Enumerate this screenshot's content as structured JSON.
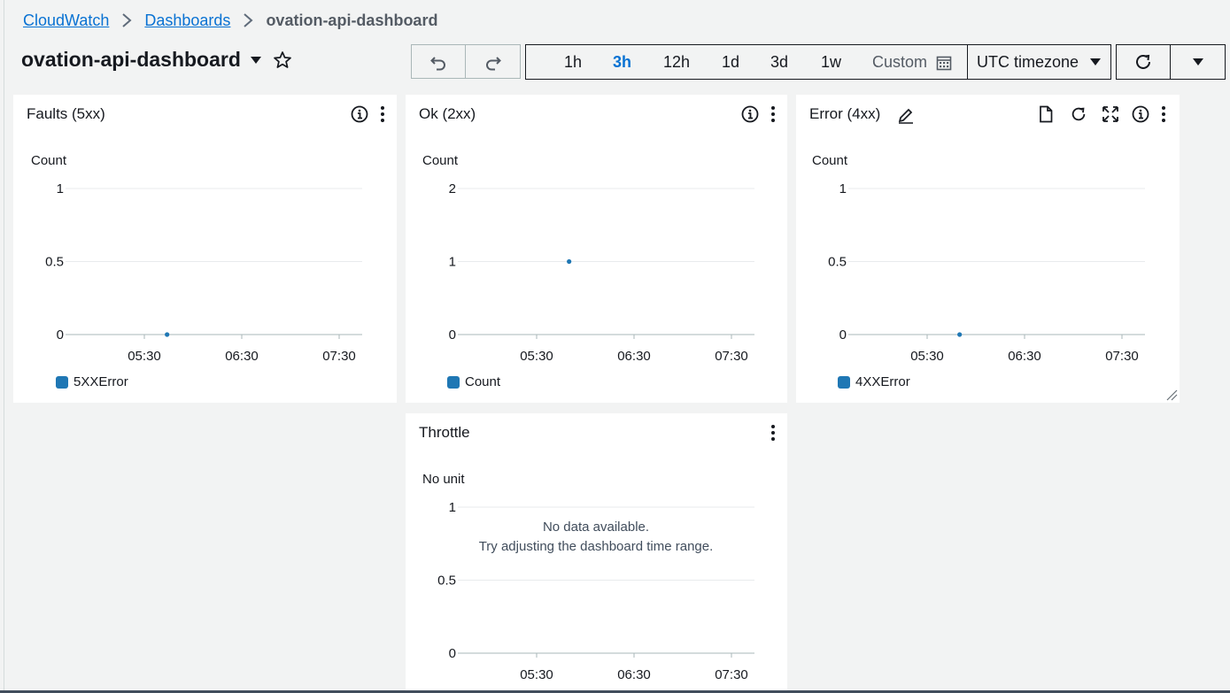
{
  "breadcrumb": {
    "root": "CloudWatch",
    "section": "Dashboards",
    "current": "ovation-api-dashboard"
  },
  "dashboard": {
    "title": "ovation-api-dashboard"
  },
  "toolbar": {
    "ranges": [
      "1h",
      "3h",
      "12h",
      "1d",
      "3d",
      "1w"
    ],
    "active_range": "3h",
    "custom_label": "Custom",
    "timezone": "UTC timezone"
  },
  "icons": {
    "undo": "undo-icon",
    "redo": "redo-icon",
    "calendar": "calendar-icon",
    "refresh": "refresh-icon",
    "caret": "caret-down-icon",
    "star": "star-icon",
    "info": "info-icon",
    "more": "more-vertical-icon",
    "edit": "pencil-icon",
    "document": "document-icon",
    "expand": "expand-icon",
    "resize": "resize-handle-icon"
  },
  "colors": {
    "link": "#0972d3",
    "series": "#1f77b4",
    "background": "#f2f3f3"
  },
  "widgets": {
    "faults": {
      "title": "Faults (5xx)",
      "unit_label": "Count",
      "legend": "5XXError"
    },
    "ok": {
      "title": "Ok (2xx)",
      "unit_label": "Count",
      "legend": "Count"
    },
    "error": {
      "title": "Error (4xx)",
      "unit_label": "Count",
      "legend": "4XXError"
    },
    "throttle": {
      "title": "Throttle",
      "unit_label": "No unit",
      "no_data_line1": "No data available.",
      "no_data_line2": "Try adjusting the dashboard time range."
    }
  },
  "chart_data": [
    {
      "type": "scatter",
      "title": "Faults (5xx)",
      "ylabel": "Count",
      "x_ticks": [
        "05:30",
        "06:30",
        "07:30"
      ],
      "y_ticks": [
        0,
        0.5,
        1
      ],
      "ylim": [
        0,
        1
      ],
      "series": [
        {
          "name": "5XXError",
          "points": [
            {
              "x": "05:44",
              "y": 0
            }
          ]
        }
      ]
    },
    {
      "type": "scatter",
      "title": "Ok (2xx)",
      "ylabel": "Count",
      "x_ticks": [
        "05:30",
        "06:30",
        "07:30"
      ],
      "y_ticks": [
        0,
        1,
        2
      ],
      "ylim": [
        0,
        2
      ],
      "series": [
        {
          "name": "Count",
          "points": [
            {
              "x": "05:50",
              "y": 1
            }
          ]
        }
      ]
    },
    {
      "type": "scatter",
      "title": "Error (4xx)",
      "ylabel": "Count",
      "x_ticks": [
        "05:30",
        "06:30",
        "07:30"
      ],
      "y_ticks": [
        0,
        0.5,
        1
      ],
      "ylim": [
        0,
        1
      ],
      "series": [
        {
          "name": "4XXError",
          "points": [
            {
              "x": "05:50",
              "y": 0
            }
          ]
        }
      ]
    },
    {
      "type": "line",
      "title": "Throttle",
      "ylabel": "No unit",
      "x_ticks": [
        "05:30",
        "06:30",
        "07:30"
      ],
      "y_ticks": [
        0,
        0.5,
        1
      ],
      "ylim": [
        0,
        1
      ],
      "series": []
    }
  ]
}
